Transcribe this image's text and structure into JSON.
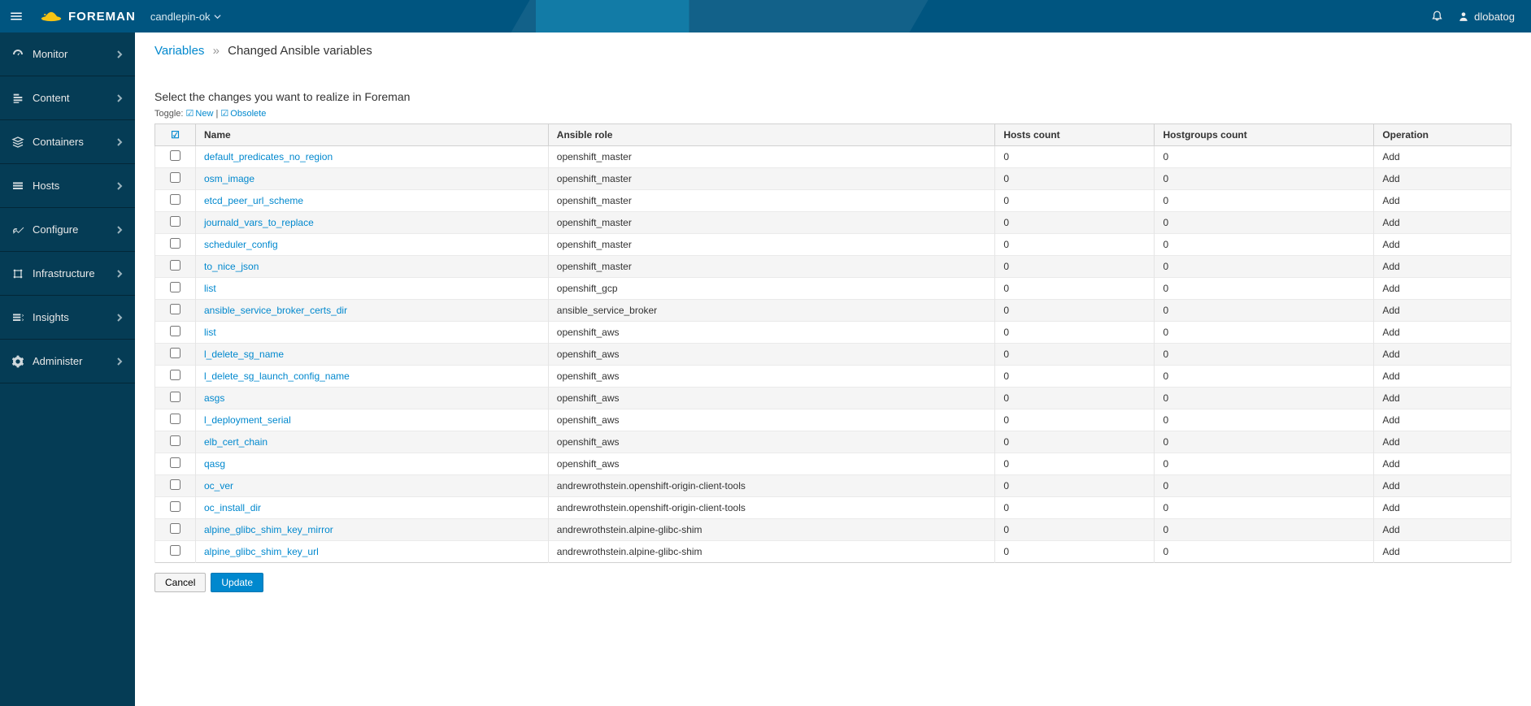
{
  "header": {
    "brand": "FOREMAN",
    "context": "candlepin-ok",
    "user": "dlobatog"
  },
  "sidebar": {
    "items": [
      {
        "label": "Monitor"
      },
      {
        "label": "Content"
      },
      {
        "label": "Containers"
      },
      {
        "label": "Hosts"
      },
      {
        "label": "Configure"
      },
      {
        "label": "Infrastructure"
      },
      {
        "label": "Insights"
      },
      {
        "label": "Administer"
      }
    ]
  },
  "breadcrumb": {
    "parent": "Variables",
    "current": "Changed Ansible variables"
  },
  "instruction": "Select the changes you want to realize in Foreman",
  "toggle": {
    "prefix": "Toggle:",
    "new_label": "New",
    "sep": " | ",
    "obsolete_label": "Obsolete"
  },
  "table": {
    "headers": {
      "name": "Name",
      "role": "Ansible role",
      "hosts": "Hosts count",
      "hostgroups": "Hostgroups count",
      "operation": "Operation"
    },
    "rows": [
      {
        "name": "default_predicates_no_region",
        "role": "openshift_master",
        "hosts": "0",
        "hostgroups": "0",
        "operation": "Add"
      },
      {
        "name": "osm_image",
        "role": "openshift_master",
        "hosts": "0",
        "hostgroups": "0",
        "operation": "Add"
      },
      {
        "name": "etcd_peer_url_scheme",
        "role": "openshift_master",
        "hosts": "0",
        "hostgroups": "0",
        "operation": "Add"
      },
      {
        "name": "journald_vars_to_replace",
        "role": "openshift_master",
        "hosts": "0",
        "hostgroups": "0",
        "operation": "Add"
      },
      {
        "name": "scheduler_config",
        "role": "openshift_master",
        "hosts": "0",
        "hostgroups": "0",
        "operation": "Add"
      },
      {
        "name": "to_nice_json",
        "role": "openshift_master",
        "hosts": "0",
        "hostgroups": "0",
        "operation": "Add"
      },
      {
        "name": "list",
        "role": "openshift_gcp",
        "hosts": "0",
        "hostgroups": "0",
        "operation": "Add"
      },
      {
        "name": "ansible_service_broker_certs_dir",
        "role": "ansible_service_broker",
        "hosts": "0",
        "hostgroups": "0",
        "operation": "Add"
      },
      {
        "name": "list",
        "role": "openshift_aws",
        "hosts": "0",
        "hostgroups": "0",
        "operation": "Add"
      },
      {
        "name": "l_delete_sg_name",
        "role": "openshift_aws",
        "hosts": "0",
        "hostgroups": "0",
        "operation": "Add"
      },
      {
        "name": "l_delete_sg_launch_config_name",
        "role": "openshift_aws",
        "hosts": "0",
        "hostgroups": "0",
        "operation": "Add"
      },
      {
        "name": "asgs",
        "role": "openshift_aws",
        "hosts": "0",
        "hostgroups": "0",
        "operation": "Add"
      },
      {
        "name": "l_deployment_serial",
        "role": "openshift_aws",
        "hosts": "0",
        "hostgroups": "0",
        "operation": "Add"
      },
      {
        "name": "elb_cert_chain",
        "role": "openshift_aws",
        "hosts": "0",
        "hostgroups": "0",
        "operation": "Add"
      },
      {
        "name": "qasg",
        "role": "openshift_aws",
        "hosts": "0",
        "hostgroups": "0",
        "operation": "Add"
      },
      {
        "name": "oc_ver",
        "role": "andrewrothstein.openshift-origin-client-tools",
        "hosts": "0",
        "hostgroups": "0",
        "operation": "Add"
      },
      {
        "name": "oc_install_dir",
        "role": "andrewrothstein.openshift-origin-client-tools",
        "hosts": "0",
        "hostgroups": "0",
        "operation": "Add"
      },
      {
        "name": "alpine_glibc_shim_key_mirror",
        "role": "andrewrothstein.alpine-glibc-shim",
        "hosts": "0",
        "hostgroups": "0",
        "operation": "Add"
      },
      {
        "name": "alpine_glibc_shim_key_url",
        "role": "andrewrothstein.alpine-glibc-shim",
        "hosts": "0",
        "hostgroups": "0",
        "operation": "Add"
      }
    ]
  },
  "buttons": {
    "cancel": "Cancel",
    "update": "Update"
  }
}
